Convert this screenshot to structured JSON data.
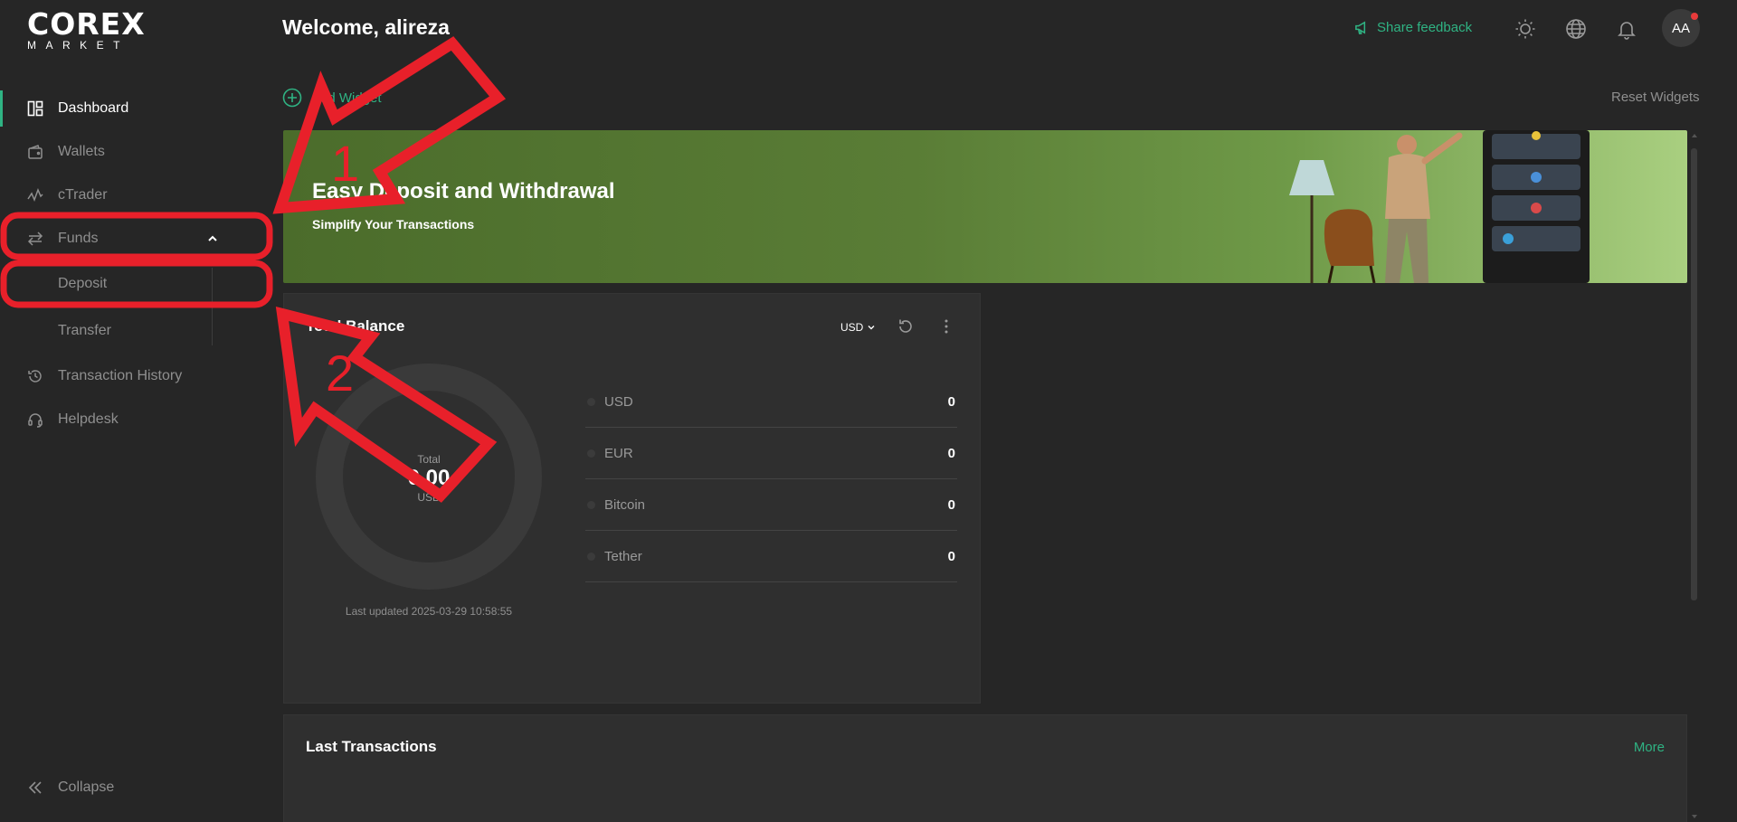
{
  "logo": {
    "top": "COREX",
    "bottom": "MARKET"
  },
  "header": {
    "welcome": "Welcome, alireza",
    "feedback": "Share feedback",
    "avatar": "AA"
  },
  "sidebar": {
    "items": [
      {
        "label": "Dashboard",
        "icon": "dashboard-icon"
      },
      {
        "label": "Wallets",
        "icon": "wallet-icon"
      },
      {
        "label": "cTrader",
        "icon": "ctrader-icon"
      },
      {
        "label": "Funds",
        "icon": "transfer-arrows-icon"
      },
      {
        "label": "Transaction History",
        "icon": "history-icon"
      },
      {
        "label": "Helpdesk",
        "icon": "headset-icon"
      }
    ],
    "funds_sub": [
      "Deposit",
      "Transfer"
    ],
    "collapse": "Collapse"
  },
  "toolbar": {
    "add_widget": "Add Widget",
    "reset": "Reset Widgets"
  },
  "banner": {
    "title": "Easy Deposit and Withdrawal",
    "subtitle": "Simplify Your Transactions"
  },
  "balance": {
    "title": "Total Balance",
    "currency": "USD",
    "total_label": "Total",
    "total_value": "0.00",
    "total_unit": "USD",
    "rows": [
      {
        "name": "USD",
        "value": "0"
      },
      {
        "name": "EUR",
        "value": "0"
      },
      {
        "name": "Bitcoin",
        "value": "0"
      },
      {
        "name": "Tether",
        "value": "0"
      }
    ],
    "updated": "Last updated 2025-03-29 10:58:55"
  },
  "transactions": {
    "title": "Last Transactions",
    "more": "More"
  },
  "annotations": {
    "one": "1",
    "two": "2"
  },
  "colors": {
    "accent": "#2fb383",
    "annotation": "#e8202a",
    "banner": "#5a7d36"
  }
}
